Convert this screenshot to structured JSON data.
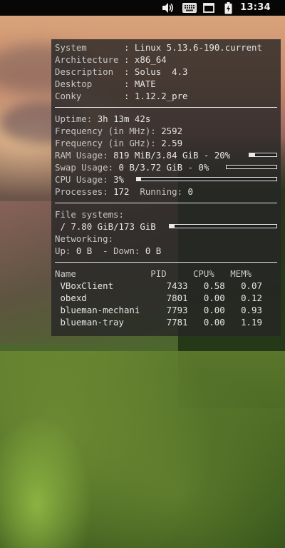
{
  "topbar": {
    "clock": "13:34",
    "icons": [
      "volume-icon",
      "keyboard-icon",
      "window-icon",
      "battery-charging-icon"
    ]
  },
  "conky": {
    "system": [
      {
        "label": "System      ",
        "value": "Linux 5.13.6-190.current"
      },
      {
        "label": "Architecture",
        "value": "x86_64"
      },
      {
        "label": "Description ",
        "value": "Solus  4.3"
      },
      {
        "label": "Desktop     ",
        "value": "MATE"
      },
      {
        "label": "Conky       ",
        "value": "1.12.2_pre"
      }
    ],
    "uptime": {
      "label": "Uptime:",
      "value": "3h 13m 42s"
    },
    "freq_mhz": {
      "label": "Frequency (in MHz):",
      "value": "2592"
    },
    "freq_ghz": {
      "label": "Frequency (in GHz):",
      "value": "2.59"
    },
    "ram": {
      "label": "RAM Usage:",
      "value": "819 MiB/3.84 GiB - 20%",
      "fraction": 0.2
    },
    "swap": {
      "label": "Swap Usage:",
      "value": "0 B/3.72 GiB - 0%",
      "fraction": 0.0
    },
    "cpu": {
      "label": "CPU Usage:",
      "value": "3%",
      "fraction": 0.03
    },
    "processes": {
      "label": "Processes:",
      "value": "172",
      "running_label": "Running:",
      "running_value": "0"
    },
    "filesystems": {
      "label": "File systems:",
      "root": "/ 7.80 GiB/173 GiB",
      "fraction": 0.045
    },
    "networking": {
      "label": "Networking:",
      "up_label": "Up:",
      "up": "0 B",
      "down_label": "- Down:",
      "down": "0 B"
    },
    "process_table": {
      "headers": [
        "Name",
        "PID",
        "CPU%",
        "MEM%"
      ],
      "rows": [
        {
          "name": "VBoxClient",
          "pid": "7433",
          "cpu": "0.58",
          "mem": "0.07"
        },
        {
          "name": "obexd",
          "pid": "7801",
          "cpu": "0.00",
          "mem": "0.12"
        },
        {
          "name": "blueman-mechani",
          "pid": "7793",
          "cpu": "0.00",
          "mem": "0.93"
        },
        {
          "name": "blueman-tray",
          "pid": "7781",
          "cpu": "0.00",
          "mem": "1.19"
        }
      ]
    }
  }
}
